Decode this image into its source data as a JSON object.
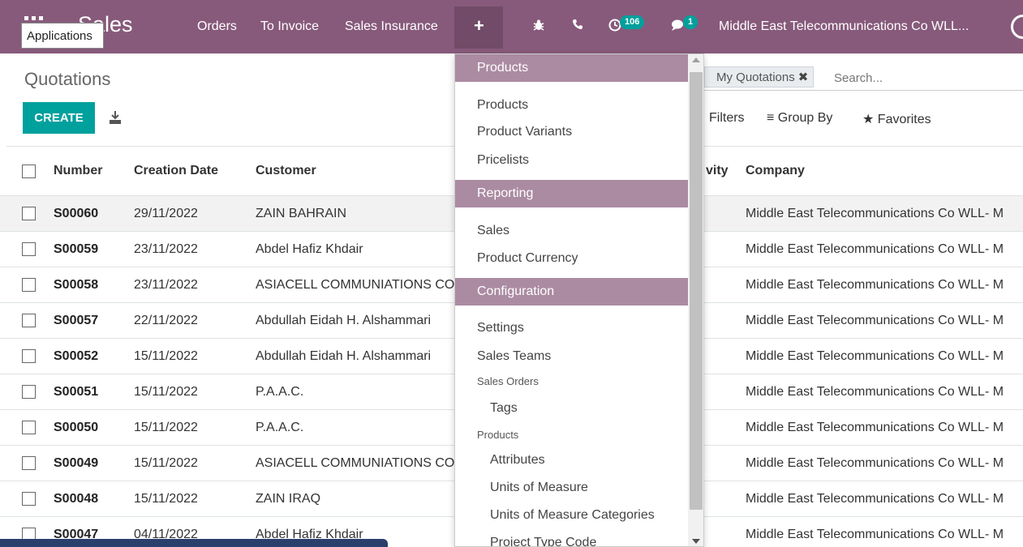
{
  "navbar": {
    "tooltip": "Applications",
    "brand": "Sales",
    "menu": [
      "Orders",
      "To Invoice",
      "Sales Insurance"
    ],
    "plus": "+",
    "activity_count": "106",
    "messages_count": "1",
    "company": "Middle East Telecommunications Co WLL...",
    "icons": [
      "apps-grid-icon",
      "bug-icon",
      "phone-icon",
      "clock-icon",
      "chat-icon"
    ],
    "color": "#875a7b"
  },
  "control": {
    "title": "Quotations",
    "create_label": "CREATE",
    "search_facet": "My Quotations",
    "search_placeholder": "Search...",
    "filters_label": "Filters",
    "group_by_label": "Group By",
    "favorites_label": "Favorites",
    "accent": "#00a09d"
  },
  "table": {
    "headers": {
      "number": "Number",
      "creation_date": "Creation Date",
      "customer": "Customer",
      "activity": "vity",
      "company": "Company"
    },
    "rows": [
      {
        "number": "S00060",
        "date": "29/11/2022",
        "customer": "ZAIN BAHRAIN",
        "company": "Middle East Telecommunications Co WLL- M"
      },
      {
        "number": "S00059",
        "date": "23/11/2022",
        "customer": "Abdel Hafiz Khdair",
        "company": "Middle East Telecommunications Co WLL- M"
      },
      {
        "number": "S00058",
        "date": "23/11/2022",
        "customer": "ASIACELL COMMUNIATIONS CO",
        "company": "Middle East Telecommunications Co WLL- M"
      },
      {
        "number": "S00057",
        "date": "22/11/2022",
        "customer": "Abdullah Eidah H. Alshammari",
        "company": "Middle East Telecommunications Co WLL- M"
      },
      {
        "number": "S00052",
        "date": "15/11/2022",
        "customer": "Abdullah Eidah H. Alshammari",
        "company": "Middle East Telecommunications Co WLL- M"
      },
      {
        "number": "S00051",
        "date": "15/11/2022",
        "customer": "P.A.A.C.",
        "company": "Middle East Telecommunications Co WLL- M"
      },
      {
        "number": "S00050",
        "date": "15/11/2022",
        "customer": "P.A.A.C.",
        "company": "Middle East Telecommunications Co WLL- M"
      },
      {
        "number": "S00049",
        "date": "15/11/2022",
        "customer": "ASIACELL COMMUNIATIONS CO",
        "company": "Middle East Telecommunications Co WLL- M"
      },
      {
        "number": "S00048",
        "date": "15/11/2022",
        "customer": "ZAIN IRAQ",
        "company": "Middle East Telecommunications Co WLL- M"
      },
      {
        "number": "S00047",
        "date": "04/11/2022",
        "customer": "Abdel Hafiz Khdair",
        "company": "Middle East Telecommunications Co WLL- M"
      }
    ]
  },
  "dropdown": {
    "sections": {
      "products": "Products",
      "reporting": "Reporting",
      "configuration": "Configuration"
    },
    "products_items": [
      "Products",
      "Product Variants",
      "Pricelists"
    ],
    "reporting_items": [
      "Sales",
      "Product Currency"
    ],
    "config_items": [
      "Settings",
      "Sales Teams"
    ],
    "sales_orders_label": "Sales Orders",
    "sales_orders_items": [
      "Tags"
    ],
    "products_sub_label": "Products",
    "products_sub_items": [
      "Attributes",
      "Units of Measure",
      "Units of Measure Categories",
      "Project Type Code"
    ],
    "header_color": "#ab8ba2"
  }
}
